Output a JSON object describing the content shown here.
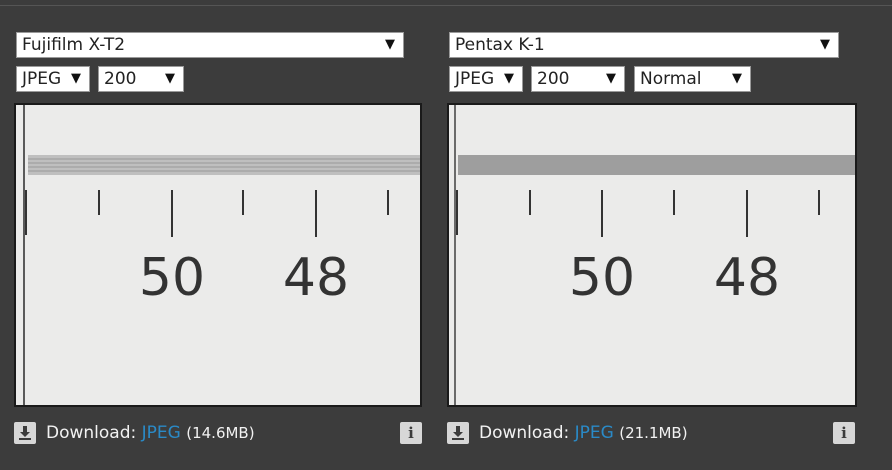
{
  "left": {
    "camera": "Fujifilm X-T2",
    "format": "JPEG",
    "iso": "200",
    "download_label": "Download:",
    "download_link": "JPEG",
    "download_size": "(14.6MB)",
    "scale_label_1": "50",
    "scale_label_2": "48"
  },
  "right": {
    "camera": "Pentax K-1",
    "format": "JPEG",
    "iso": "200",
    "mode": "Normal",
    "download_label": "Download:",
    "download_link": "JPEG",
    "download_size": "(21.1MB)",
    "scale_label_1": "50",
    "scale_label_2": "48"
  },
  "ui": {
    "dropdown_arrow": "▼",
    "info_glyph": "i",
    "accent_color": "#2a8ac7"
  }
}
